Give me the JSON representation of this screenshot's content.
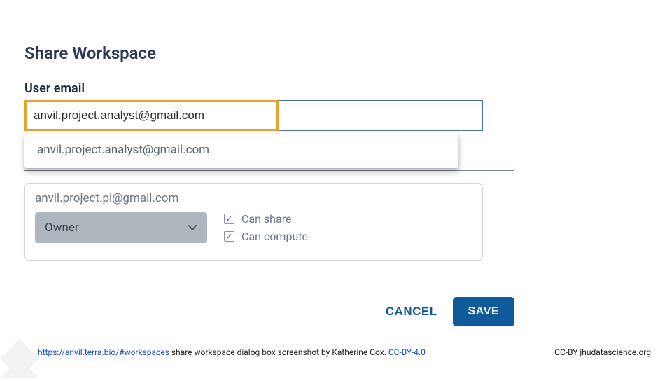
{
  "dialog": {
    "title": "Share Workspace",
    "email_field": {
      "label": "User email",
      "value": "anvil.project.analyst@gmail.com"
    },
    "autocomplete": {
      "suggestion": "anvil.project.analyst@gmail.com"
    },
    "collaborator": {
      "email": "anvil.project.pi@gmail.com",
      "role": "Owner",
      "can_share_label": "Can share",
      "can_compute_label": "Can compute",
      "can_share_checked": true,
      "can_compute_checked": true
    },
    "actions": {
      "cancel": "CANCEL",
      "save": "SAVE"
    }
  },
  "footer": {
    "link_text": "https://anvil.terra.bio/#workspaces",
    "left_text": " share  workspace dialog box screenshot by Katherine Cox.  ",
    "license_text": "CC-BY-4.0",
    "right_text": "CC-BY  jhudatascience.org"
  },
  "colors": {
    "accent_orange": "#e8a22f",
    "primary_blue": "#0e5a9a"
  }
}
